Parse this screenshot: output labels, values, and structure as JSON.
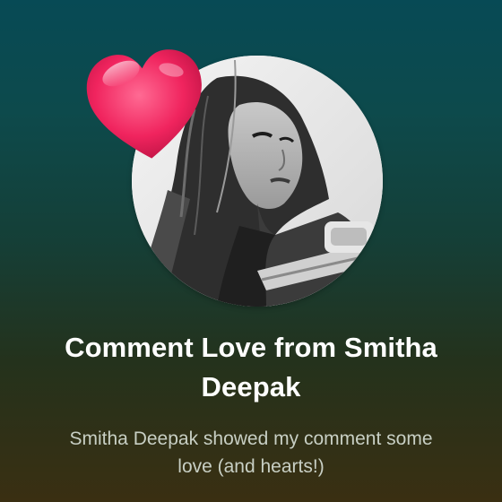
{
  "card": {
    "title": "Comment Love from Smitha Deepak",
    "subtitle": "Smitha Deepak showed my comment some love (and hearts!)"
  },
  "icons": {
    "heart": "heart-icon",
    "avatar": "user-avatar-photo"
  },
  "colors": {
    "background_top": "#074a55",
    "background_bottom": "#3a2f12",
    "heart": "#f0245e",
    "title": "#ffffff",
    "subtitle": "#c8cfc4"
  }
}
